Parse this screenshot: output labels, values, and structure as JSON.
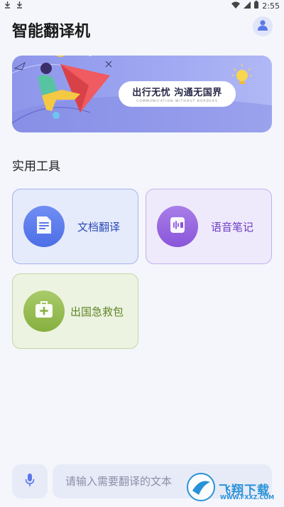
{
  "status_bar": {
    "time": "2:55",
    "left_icons": [
      "download-icon",
      "download-icon"
    ],
    "right_icons": [
      "wifi-icon",
      "signal-icon",
      "battery-icon"
    ]
  },
  "app_bar": {
    "title": "智能翻译机",
    "avatar_icon": "user-icon"
  },
  "banner": {
    "slogan": "出行无忧 沟通无国界",
    "subtitle": "COMMUNICATION WITHOUT BORDERS"
  },
  "tools_section": {
    "title": "实用工具",
    "items": [
      {
        "label": "文档翻译",
        "icon": "document-icon",
        "color": "#4d6ee6"
      },
      {
        "label": "语音笔记",
        "icon": "voice-note-icon",
        "color": "#8a55da"
      },
      {
        "label": "出国急救包",
        "icon": "first-aid-kit-icon",
        "color": "#86b040"
      }
    ]
  },
  "bottom_input": {
    "placeholder": "请输入需要翻译的文本",
    "mic_icon": "microphone-icon"
  },
  "watermark": {
    "text": "飞翔下载",
    "url": "WWW.FXXZ.COM"
  }
}
